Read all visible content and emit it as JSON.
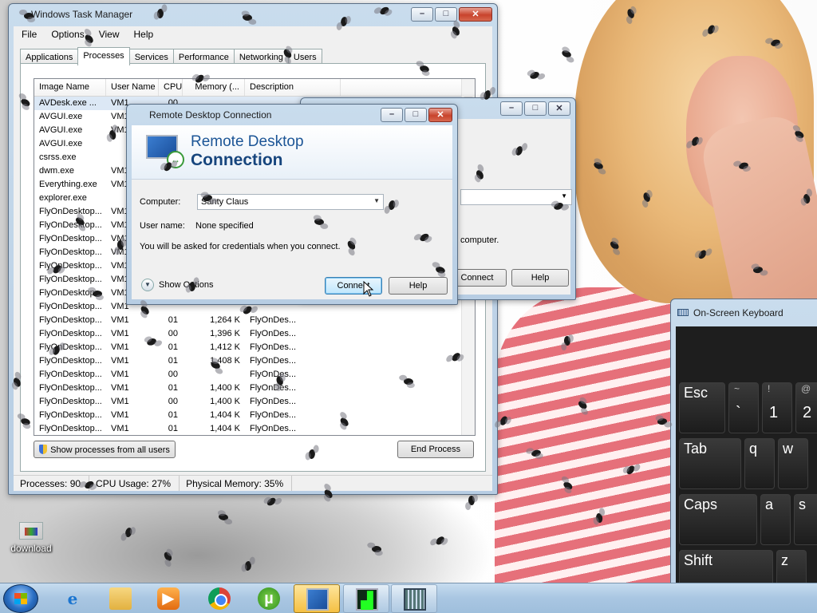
{
  "desktop": {
    "icon_label": "download"
  },
  "task_manager": {
    "title": "Windows Task Manager",
    "menu": [
      "File",
      "Options",
      "View",
      "Help"
    ],
    "tabs": [
      "Applications",
      "Processes",
      "Services",
      "Performance",
      "Networking",
      "Users"
    ],
    "active_tab": "Processes",
    "columns": [
      "Image Name",
      "User Name",
      "CPU",
      "Memory (...",
      "Description"
    ],
    "rows": [
      {
        "name": "AVDesk.exe ...",
        "user": "VM1",
        "cpu": "00",
        "mem": "",
        "desc": ""
      },
      {
        "name": "AVGUI.exe",
        "user": "VM1",
        "cpu": "",
        "mem": "",
        "desc": ""
      },
      {
        "name": "AVGUI.exe",
        "user": "VM1",
        "cpu": "",
        "mem": "",
        "desc": ""
      },
      {
        "name": "AVGUI.exe",
        "user": "",
        "cpu": "",
        "mem": "",
        "desc": ""
      },
      {
        "name": "csrss.exe",
        "user": "",
        "cpu": "",
        "mem": "",
        "desc": ""
      },
      {
        "name": "dwm.exe",
        "user": "VM1",
        "cpu": "",
        "mem": "",
        "desc": ""
      },
      {
        "name": "Everything.exe",
        "user": "VM1",
        "cpu": "",
        "mem": "",
        "desc": ""
      },
      {
        "name": "explorer.exe",
        "user": "",
        "cpu": "",
        "mem": "",
        "desc": ""
      },
      {
        "name": "FlyOnDesktop...",
        "user": "VM1",
        "cpu": "",
        "mem": "",
        "desc": ""
      },
      {
        "name": "FlyOnDesktop...",
        "user": "VM1",
        "cpu": "",
        "mem": "",
        "desc": ""
      },
      {
        "name": "FlyOnDesktop...",
        "user": "VM1",
        "cpu": "",
        "mem": "",
        "desc": ""
      },
      {
        "name": "FlyOnDesktop...",
        "user": "VM1",
        "cpu": "",
        "mem": "",
        "desc": ""
      },
      {
        "name": "FlyOnDesktop...",
        "user": "VM1",
        "cpu": "",
        "mem": "",
        "desc": ""
      },
      {
        "name": "FlyOnDesktop...",
        "user": "VM1",
        "cpu": "",
        "mem": "",
        "desc": ""
      },
      {
        "name": "FlyOnDesktop...",
        "user": "VM1",
        "cpu": "",
        "mem": "",
        "desc": ""
      },
      {
        "name": "FlyOnDesktop...",
        "user": "VM1",
        "cpu": "",
        "mem": "",
        "desc": ""
      },
      {
        "name": "FlyOnDesktop...",
        "user": "VM1",
        "cpu": "01",
        "mem": "1,264 K",
        "desc": "FlyOnDes..."
      },
      {
        "name": "FlyOnDesktop...",
        "user": "VM1",
        "cpu": "00",
        "mem": "1,396 K",
        "desc": "FlyOnDes..."
      },
      {
        "name": "FlyOnDesktop...",
        "user": "VM1",
        "cpu": "01",
        "mem": "1,412 K",
        "desc": "FlyOnDes..."
      },
      {
        "name": "FlyOnDesktop...",
        "user": "VM1",
        "cpu": "01",
        "mem": "1,408 K",
        "desc": "FlyOnDes..."
      },
      {
        "name": "FlyOnDesktop...",
        "user": "VM1",
        "cpu": "00",
        "mem": "",
        "desc": "FlyOnDes..."
      },
      {
        "name": "FlyOnDesktop...",
        "user": "VM1",
        "cpu": "01",
        "mem": "1,400 K",
        "desc": "FlyOnDes..."
      },
      {
        "name": "FlyOnDesktop...",
        "user": "VM1",
        "cpu": "00",
        "mem": "1,400 K",
        "desc": "FlyOnDes..."
      },
      {
        "name": "FlyOnDesktop...",
        "user": "VM1",
        "cpu": "01",
        "mem": "1,404 K",
        "desc": "FlyOnDes..."
      },
      {
        "name": "FlyOnDesktop...",
        "user": "VM1",
        "cpu": "01",
        "mem": "1,404 K",
        "desc": "FlyOnDes..."
      }
    ],
    "show_all_label": "Show processes from all users",
    "end_process_label": "End Process",
    "status": {
      "processes": "Processes: 90",
      "cpu": "CPU Usage: 27%",
      "memory": "Physical Memory: 35%"
    }
  },
  "rdp_back": {
    "visible_text_computer": "computer.",
    "connect_label": "Connect",
    "help_label": "Help"
  },
  "rdp": {
    "title": "Remote Desktop Connection",
    "banner_line1": "Remote Desktop",
    "banner_line2": "Connection",
    "computer_label": "Computer:",
    "computer_value": "Santy Claus",
    "username_label": "User name:",
    "username_value": "None specified",
    "info": "You will be asked for credentials when you connect.",
    "show_options": "Show Options",
    "connect_label": "Connect",
    "help_label": "Help"
  },
  "osk": {
    "title": "On-Screen Keyboard",
    "keys": {
      "esc": "Esc",
      "tilde_top": "~",
      "tilde_bottom": "`",
      "one_top": "!",
      "one_bottom": "1",
      "two_top": "@",
      "two_bottom": "2",
      "tab": "Tab",
      "q": "q",
      "w": "w",
      "caps": "Caps",
      "a": "a",
      "s": "s",
      "shift": "Shift",
      "z": "z"
    }
  },
  "taskbar": {
    "items": [
      "start-button",
      "internet-explorer",
      "file-explorer",
      "media-player",
      "chrome",
      "utorrent",
      "remote-desktop",
      "task-manager",
      "on-screen-keyboard"
    ],
    "active": "remote-desktop"
  }
}
